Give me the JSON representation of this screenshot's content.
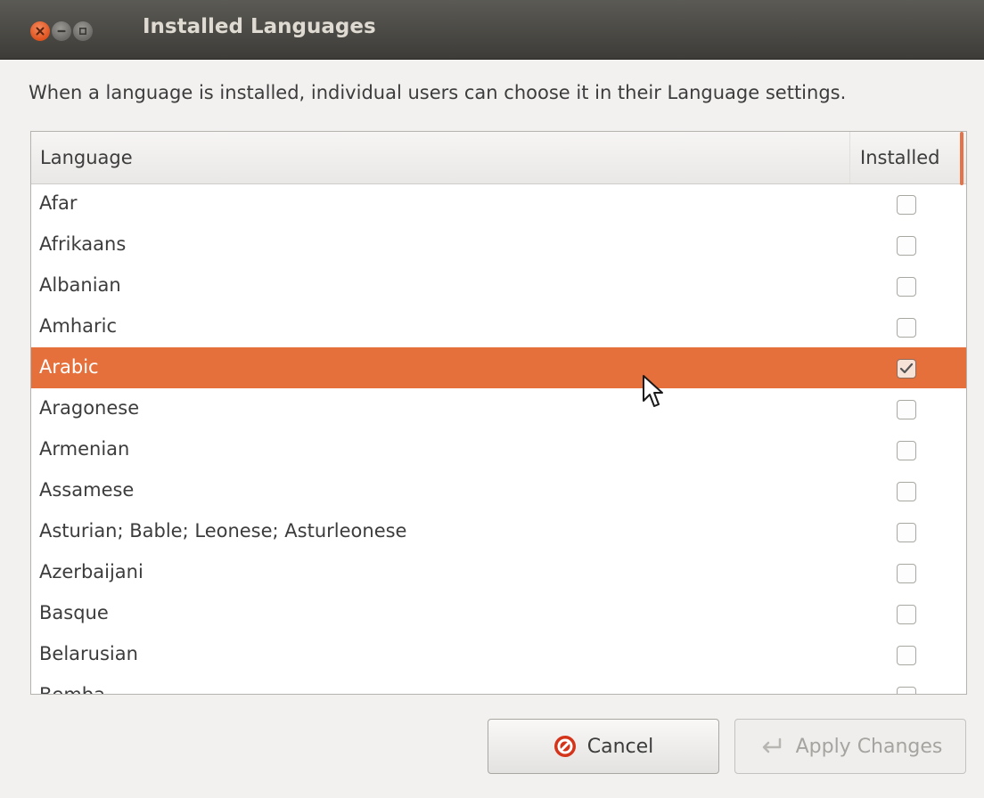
{
  "window": {
    "title": "Installed Languages"
  },
  "description": "When a language is installed, individual users can choose it in their Language settings.",
  "table": {
    "columns": [
      "Language",
      "Installed"
    ],
    "rows": [
      {
        "language": "Afar",
        "installed": false
      },
      {
        "language": "Afrikaans",
        "installed": false
      },
      {
        "language": "Albanian",
        "installed": false
      },
      {
        "language": "Amharic",
        "installed": false
      },
      {
        "language": "Arabic",
        "installed": true,
        "selected": true
      },
      {
        "language": "Aragonese",
        "installed": false
      },
      {
        "language": "Armenian",
        "installed": false
      },
      {
        "language": "Assamese",
        "installed": false
      },
      {
        "language": "Asturian; Bable; Leonese; Asturleonese",
        "installed": false
      },
      {
        "language": "Azerbaijani",
        "installed": false
      },
      {
        "language": "Basque",
        "installed": false
      },
      {
        "language": "Belarusian",
        "installed": false
      },
      {
        "language": "Bemba",
        "installed": false
      }
    ]
  },
  "buttons": {
    "cancel_label": "Cancel",
    "apply_label": "Apply Changes"
  },
  "colors": {
    "accent": "#e6703c",
    "titlebar": "#3d3c38"
  }
}
